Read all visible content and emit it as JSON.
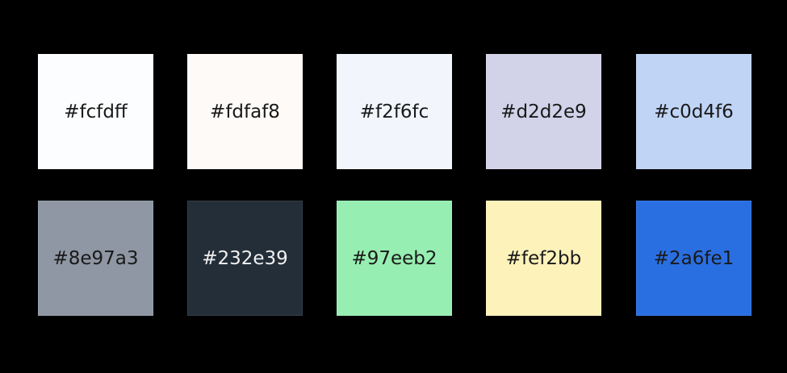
{
  "swatches": [
    {
      "label": "#fcfdff",
      "color": "#fcfdff"
    },
    {
      "label": "#fdfaf8",
      "color": "#fdfaf8"
    },
    {
      "label": "#f2f6fc",
      "color": "#f2f6fc"
    },
    {
      "label": "#d2d2e9",
      "color": "#d2d2e9"
    },
    {
      "label": "#c0d4f6",
      "color": "#c0d4f6"
    },
    {
      "label": "#8e97a3",
      "color": "#8e97a3"
    },
    {
      "label": "#232e39",
      "color": "#232e39"
    },
    {
      "label": "#97eeb2",
      "color": "#97eeb2"
    },
    {
      "label": "#fef2bb",
      "color": "#fef2bb"
    },
    {
      "label": "#2a6fe1",
      "color": "#2a6fe1"
    }
  ]
}
